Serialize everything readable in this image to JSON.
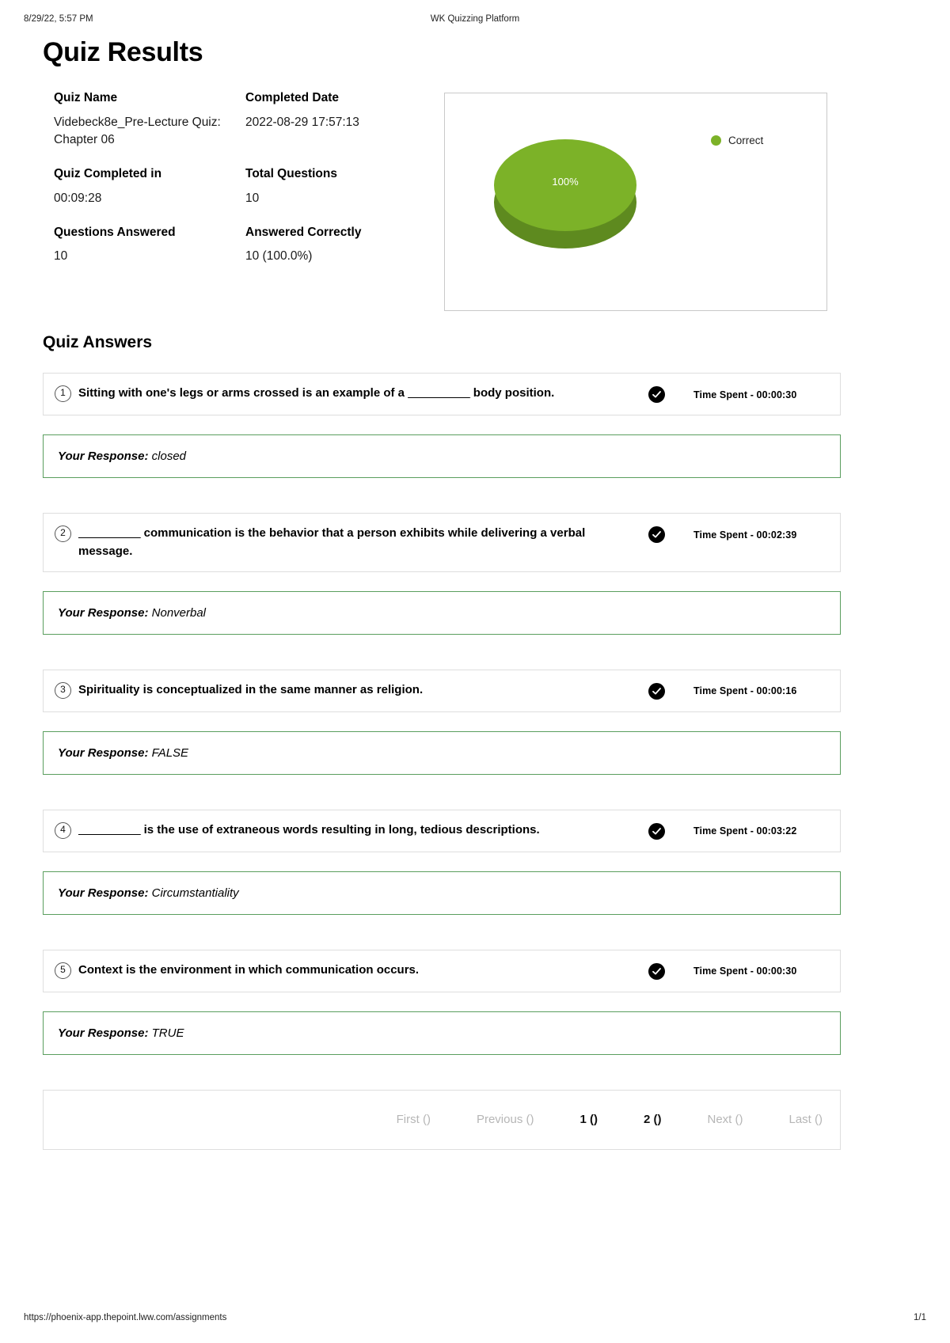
{
  "print_header": {
    "left": "8/29/22, 5:57 PM",
    "center": "WK Quizzing Platform"
  },
  "print_footer": {
    "url": "https://phoenix-app.thepoint.lww.com/assignments",
    "page": "1/1"
  },
  "page_title": "Quiz Results",
  "summary": {
    "quiz_name_label": "Quiz Name",
    "quiz_name_value": "Videbeck8e_Pre-Lecture Quiz: Chapter 06",
    "completed_date_label": "Completed Date",
    "completed_date_value": "2022-08-29 17:57:13",
    "completed_in_label": "Quiz Completed in",
    "completed_in_value": "00:09:28",
    "total_questions_label": "Total Questions",
    "total_questions_value": "10",
    "questions_answered_label": "Questions Answered",
    "questions_answered_value": "10",
    "answered_correctly_label": "Answered Correctly",
    "answered_correctly_value": "10 (100.0%)"
  },
  "chart_data": {
    "type": "pie",
    "title": "",
    "categories": [
      "Correct"
    ],
    "values": [
      100
    ],
    "value_labels": [
      "100%"
    ],
    "colors": [
      "#7cb228"
    ],
    "side_color": "#5e8a1f",
    "legend": [
      "Correct"
    ],
    "legend_position": "right",
    "three_d": true,
    "units": "percent"
  },
  "answers_section_title": "Quiz Answers",
  "check_icon_name": "check-circle-icon",
  "response_label": "Your Response:",
  "time_spent_prefix": "Time Spent - ",
  "questions": [
    {
      "number": "1",
      "text_before": "Sitting with one's legs or arms crossed is an example of a ",
      "blank": "__________",
      "text_after": " body position.",
      "time_spent": "Time Spent - 00:00:30",
      "response_label": "Your Response:",
      "response": "closed",
      "correct": true
    },
    {
      "number": "2",
      "text_before": "",
      "blank": "__________",
      "text_after": " communication is the behavior that a person exhibits while delivering a verbal message.",
      "time_spent": "Time Spent - 00:02:39",
      "response_label": "Your Response:",
      "response": "Nonverbal",
      "correct": true
    },
    {
      "number": "3",
      "text_before": "Spirituality is conceptualized in the same manner as religion.",
      "blank": "",
      "text_after": "",
      "time_spent": "Time Spent - 00:00:16",
      "response_label": "Your Response:",
      "response": "FALSE",
      "correct": true
    },
    {
      "number": "4",
      "text_before": "",
      "blank": "__________",
      "text_after": " is the use of extraneous words resulting in long, tedious descriptions.",
      "time_spent": "Time Spent - 00:03:22",
      "response_label": "Your Response:",
      "response": "Circumstantiality",
      "correct": true
    },
    {
      "number": "5",
      "text_before": "Context is the environment in which communication occurs.",
      "blank": "",
      "text_after": "",
      "time_spent": "Time Spent - 00:00:30",
      "response_label": "Your Response:",
      "response": "TRUE",
      "correct": true
    }
  ],
  "pagination": [
    {
      "label": "First ()",
      "state": "disabled"
    },
    {
      "label": "Previous ()",
      "state": "disabled"
    },
    {
      "label": "1 ()",
      "state": "active"
    },
    {
      "label": "2 ()",
      "state": "num"
    },
    {
      "label": "Next ()",
      "state": "disabled"
    },
    {
      "label": "Last ()",
      "state": "disabled"
    }
  ]
}
